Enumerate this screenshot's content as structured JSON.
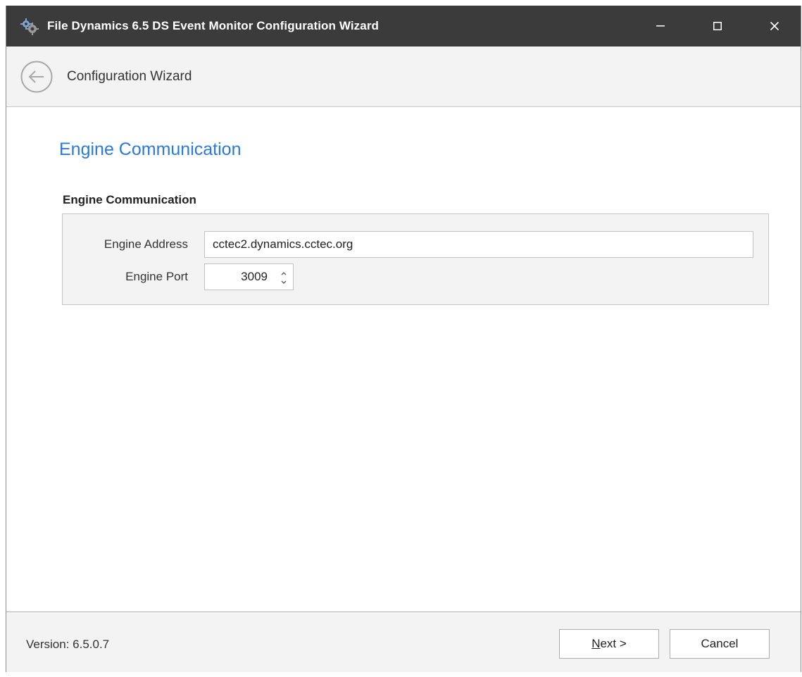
{
  "window": {
    "title": "File Dynamics 6.5 DS Event Monitor Configuration Wizard",
    "icons": {
      "app": "gears-icon",
      "minimize": "minimize-icon",
      "maximize": "maximize-icon",
      "close": "close-icon"
    }
  },
  "nav": {
    "back_icon": "back-arrow-icon",
    "title": "Configuration Wizard"
  },
  "page": {
    "heading": "Engine Communication",
    "group_label": "Engine Communication",
    "fields": {
      "engine_address_label": "Engine Address",
      "engine_address_value": "cctec2.dynamics.cctec.org",
      "engine_port_label": "Engine Port",
      "engine_port_value": "3009"
    }
  },
  "footer": {
    "version": "Version: 6.5.0.7",
    "next_mnemonic": "N",
    "next_rest": "ext >",
    "cancel_label": "Cancel"
  },
  "colors": {
    "titlebar": "#3b3b3b",
    "heading": "#2b7bd6",
    "panel": "#f3f3f3"
  }
}
